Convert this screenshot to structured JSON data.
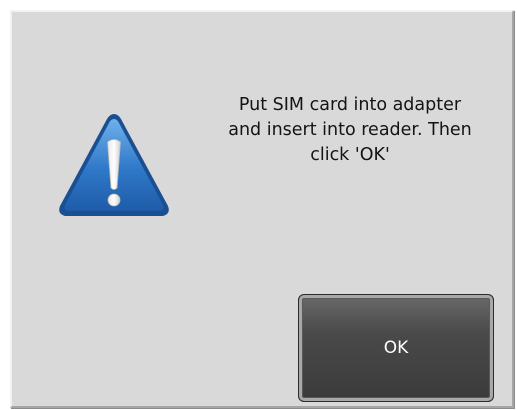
{
  "dialog": {
    "icon": "warning-triangle-icon",
    "message": "Put SIM card into adapter\nand insert into reader. Then\nclick 'OK'",
    "ok_label": "OK"
  },
  "colors": {
    "dialog_background": "#d9d9d9",
    "warning_blue": "#2f78c8",
    "button_dark": "#3a3a3a",
    "button_text": "#ffffff"
  }
}
